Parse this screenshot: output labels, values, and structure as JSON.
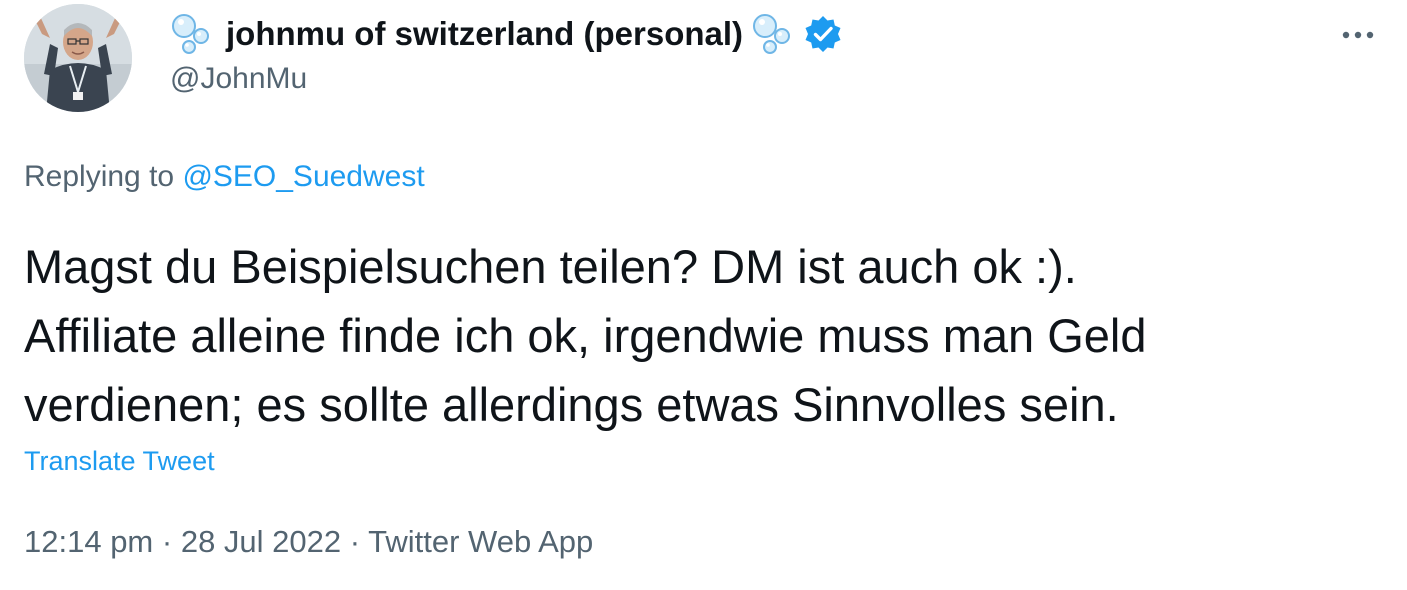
{
  "author": {
    "display_name": "johnmu of switzerland (personal)",
    "handle": "@JohnMu",
    "avatar_icon": "avatar-photo",
    "name_emoji": "bubbles-icon",
    "verified_icon": "verified-badge-icon"
  },
  "reply": {
    "prefix": "Replying to",
    "to_handle": "@SEO_Suedwest"
  },
  "tweet": {
    "line1": "Magst du Beispielsuchen teilen? DM ist auch ok :).",
    "line2": "Affiliate alleine finde ich ok, irgendwie muss man Geld",
    "line3": "verdienen; es sollte allerdings etwas Sinnvolles sein."
  },
  "translate_label": "Translate Tweet",
  "meta": {
    "time": "12:14 pm",
    "separator": " · ",
    "date": "28 Jul 2022",
    "source": "Twitter Web App"
  },
  "more_icon": "more-dots-icon",
  "colors": {
    "text": "#0f1419",
    "secondary": "#536471",
    "link": "#1d9bf0",
    "verified": "#1d9bf0"
  }
}
